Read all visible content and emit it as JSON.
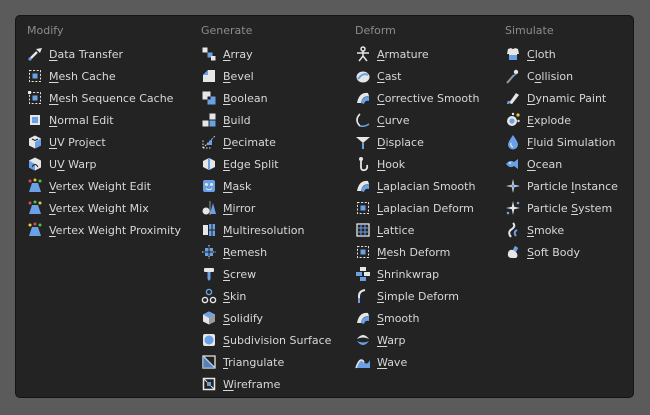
{
  "columns": [
    {
      "key": "modify",
      "header": "Modify",
      "items": [
        {
          "label": "Data Transfer",
          "icon": "data-transfer-icon",
          "ul": 0
        },
        {
          "label": "Mesh Cache",
          "icon": "mesh-cache-icon",
          "ul": 0
        },
        {
          "label": "Mesh Sequence Cache",
          "icon": "mesh-sequence-cache-icon",
          "ul": 0
        },
        {
          "label": "Normal Edit",
          "icon": "normal-edit-icon",
          "ul": 0
        },
        {
          "label": "UV Project",
          "icon": "uv-project-icon",
          "ul": 0
        },
        {
          "label": "UV Warp",
          "icon": "uv-warp-icon",
          "ul": 1
        },
        {
          "label": "Vertex Weight Edit",
          "icon": "vertex-weight-edit-icon",
          "ul": 0
        },
        {
          "label": "Vertex Weight Mix",
          "icon": "vertex-weight-mix-icon",
          "ul": 0
        },
        {
          "label": "Vertex Weight Proximity",
          "icon": "vertex-weight-proximity-icon",
          "ul": 0
        }
      ]
    },
    {
      "key": "generate",
      "header": "Generate",
      "items": [
        {
          "label": "Array",
          "icon": "array-icon",
          "ul": 0
        },
        {
          "label": "Bevel",
          "icon": "bevel-icon",
          "ul": 0
        },
        {
          "label": "Boolean",
          "icon": "boolean-icon",
          "ul": 0
        },
        {
          "label": "Build",
          "icon": "build-icon",
          "ul": 0
        },
        {
          "label": "Decimate",
          "icon": "decimate-icon",
          "ul": 0
        },
        {
          "label": "Edge Split",
          "icon": "edge-split-icon",
          "ul": 0
        },
        {
          "label": "Mask",
          "icon": "mask-icon",
          "ul": 0
        },
        {
          "label": "Mirror",
          "icon": "mirror-icon",
          "ul": 0
        },
        {
          "label": "Multiresolution",
          "icon": "multiresolution-icon",
          "ul": 0
        },
        {
          "label": "Remesh",
          "icon": "remesh-icon",
          "ul": 0
        },
        {
          "label": "Screw",
          "icon": "screw-icon",
          "ul": 0
        },
        {
          "label": "Skin",
          "icon": "skin-icon",
          "ul": 0
        },
        {
          "label": "Solidify",
          "icon": "solidify-icon",
          "ul": 0
        },
        {
          "label": "Subdivision Surface",
          "icon": "subdivision-surface-icon",
          "ul": 0
        },
        {
          "label": "Triangulate",
          "icon": "triangulate-icon",
          "ul": 0
        },
        {
          "label": "Wireframe",
          "icon": "wireframe-icon",
          "ul": 0
        }
      ]
    },
    {
      "key": "deform",
      "header": "Deform",
      "items": [
        {
          "label": "Armature",
          "icon": "armature-icon",
          "ul": 0
        },
        {
          "label": "Cast",
          "icon": "cast-icon",
          "ul": 0
        },
        {
          "label": "Corrective Smooth",
          "icon": "corrective-smooth-icon",
          "ul": 0
        },
        {
          "label": "Curve",
          "icon": "curve-icon",
          "ul": 0
        },
        {
          "label": "Displace",
          "icon": "displace-icon",
          "ul": 0
        },
        {
          "label": "Hook",
          "icon": "hook-icon",
          "ul": 0
        },
        {
          "label": "Laplacian Smooth",
          "icon": "laplacian-smooth-icon",
          "ul": 0
        },
        {
          "label": "Laplacian Deform",
          "icon": "laplacian-deform-icon",
          "ul": 0
        },
        {
          "label": "Lattice",
          "icon": "lattice-icon",
          "ul": 0
        },
        {
          "label": "Mesh Deform",
          "icon": "mesh-deform-icon",
          "ul": 0
        },
        {
          "label": "Shrinkwrap",
          "icon": "shrinkwrap-icon",
          "ul": 0
        },
        {
          "label": "Simple Deform",
          "icon": "simple-deform-icon",
          "ul": 0
        },
        {
          "label": "Smooth",
          "icon": "smooth-icon",
          "ul": 0
        },
        {
          "label": "Warp",
          "icon": "warp-icon",
          "ul": 0
        },
        {
          "label": "Wave",
          "icon": "wave-icon",
          "ul": 0
        }
      ]
    },
    {
      "key": "simulate",
      "header": "Simulate",
      "items": [
        {
          "label": "Cloth",
          "icon": "cloth-icon",
          "ul": 0
        },
        {
          "label": "Collision",
          "icon": "collision-icon",
          "ul": 1
        },
        {
          "label": "Dynamic Paint",
          "icon": "dynamic-paint-icon",
          "ul": 0
        },
        {
          "label": "Explode",
          "icon": "explode-icon",
          "ul": 0
        },
        {
          "label": "Fluid Simulation",
          "icon": "fluid-simulation-icon",
          "ul": 0
        },
        {
          "label": "Ocean",
          "icon": "ocean-icon",
          "ul": 0
        },
        {
          "label": "Particle Instance",
          "icon": "particle-instance-icon",
          "ul": 9
        },
        {
          "label": "Particle System",
          "icon": "particle-system-icon",
          "ul": 9
        },
        {
          "label": "Smoke",
          "icon": "smoke-icon",
          "ul": 0
        },
        {
          "label": "Soft Body",
          "icon": "soft-body-icon",
          "ul": 0
        }
      ]
    }
  ],
  "colors": {
    "menu_background": "#232323",
    "menu_border": "#141414",
    "page_background": "#5b5b5b",
    "header_text": "#8c8c8c",
    "item_text": "#d8d8d8",
    "icon_accent": "#6aa1e6"
  }
}
